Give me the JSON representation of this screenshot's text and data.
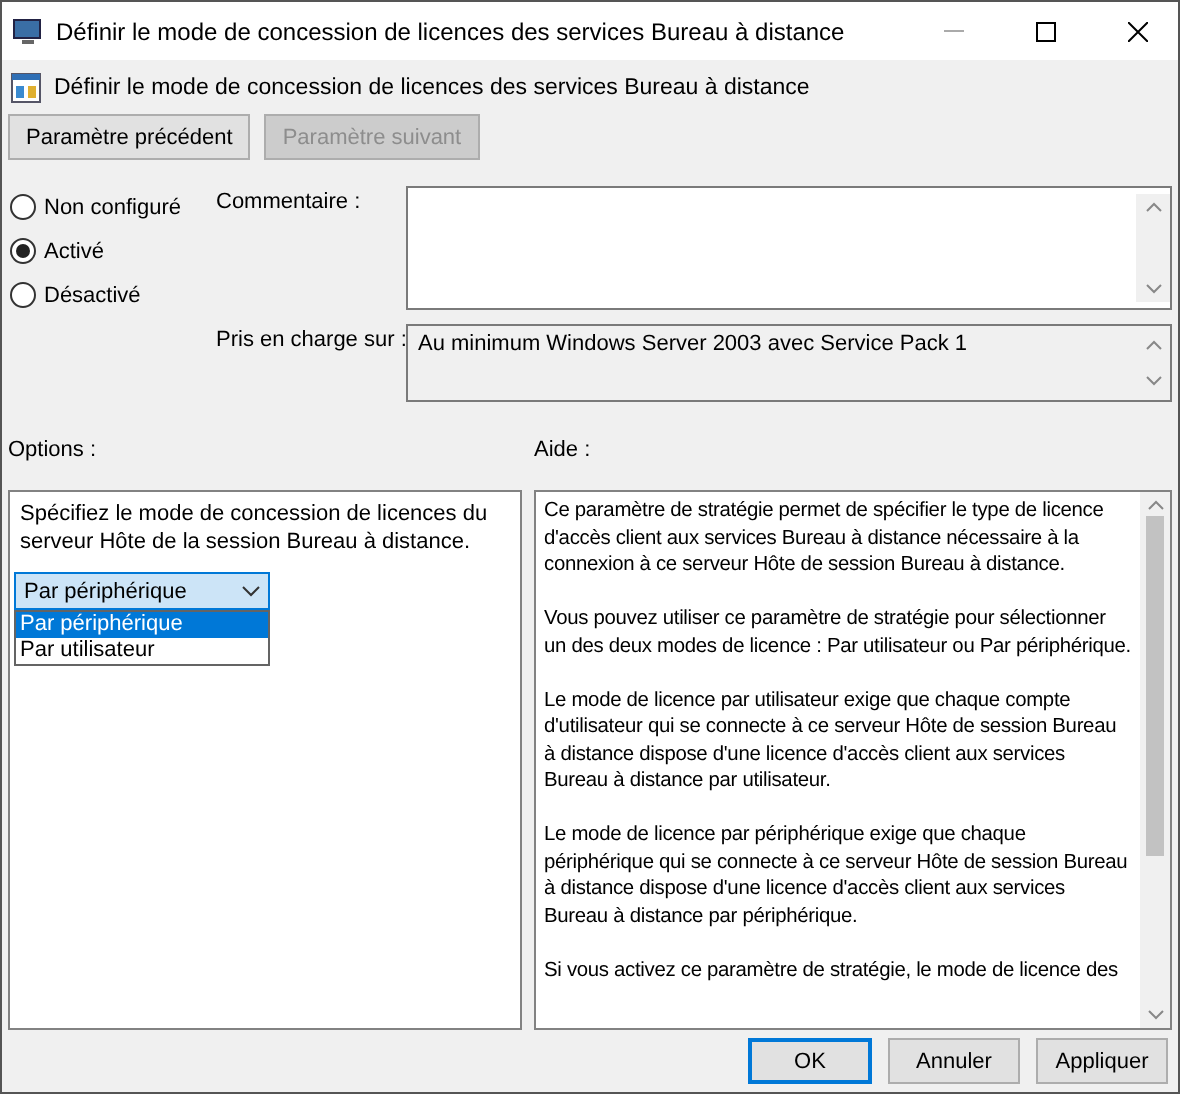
{
  "window": {
    "title": "Définir le mode de concession de licences des services Bureau à distance"
  },
  "header": {
    "title": "Définir le mode de concession de licences des services Bureau à distance"
  },
  "nav_buttons": [
    {
      "label": "Paramètre précédent",
      "disabled": false
    },
    {
      "label": "Paramètre suivant",
      "disabled": true
    }
  ],
  "state_options": [
    {
      "label": "Non configuré",
      "selected": false
    },
    {
      "label": "Activé",
      "selected": true
    },
    {
      "label": "Désactivé",
      "selected": false
    }
  ],
  "comment": {
    "label": "Commentaire :"
  },
  "supported": {
    "label": "Pris en charge sur :",
    "value": "Au minimum Windows Server 2003 avec Service Pack 1"
  },
  "options": {
    "label": "Options :",
    "description": "Spécifiez le mode de concession de licences du serveur Hôte de la session Bureau à distance.",
    "dropdown": {
      "value": "Par périphérique",
      "expanded": true,
      "items": [
        {
          "label": "Par périphérique",
          "selected": true
        },
        {
          "label": "Par utilisateur",
          "selected": false
        }
      ]
    }
  },
  "help": {
    "label": "Aide :",
    "paragraphs": [
      "Ce paramètre de stratégie permet de spécifier le type de licence d'accès client aux services Bureau à distance nécessaire à la connexion à ce serveur Hôte de session Bureau à distance.",
      "Vous pouvez utiliser ce paramètre de stratégie pour sélectionner un des deux modes de licence : Par utilisateur ou Par périphérique.",
      "Le mode de licence par utilisateur exige que chaque compte d'utilisateur qui se connecte à ce serveur Hôte de session Bureau à distance dispose d'une licence d'accès client aux services Bureau à distance par utilisateur.",
      "Le mode de licence par périphérique exige que chaque périphérique qui se connecte à ce serveur Hôte de session Bureau à distance dispose d'une licence d'accès client aux services Bureau à distance par périphérique.",
      "Si vous activez ce paramètre de stratégie, le mode de licence des"
    ]
  },
  "footer_buttons": [
    {
      "label": "OK",
      "kind": "default"
    },
    {
      "label": "Annuler",
      "kind": "normal"
    },
    {
      "label": "Appliquer",
      "kind": "normal"
    }
  ]
}
